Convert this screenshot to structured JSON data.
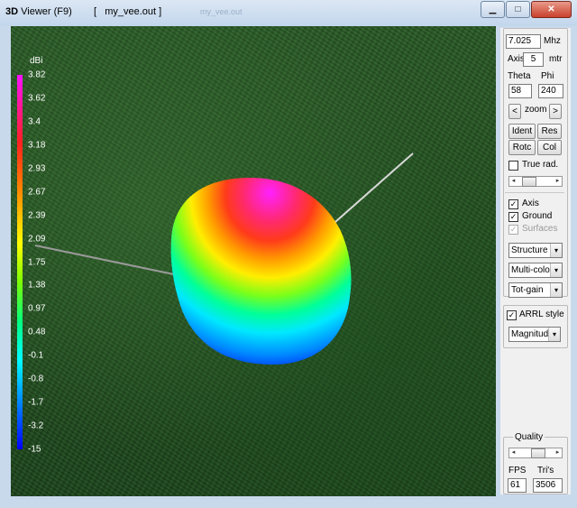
{
  "window": {
    "title_prefix": "3D",
    "title_main": "Viewer (F9)",
    "title_file": "[   my_vee.out ]",
    "ghost_title": "my_vee.out",
    "buttons": {
      "minimize": "▁",
      "maximize": "□",
      "close": "✕"
    }
  },
  "scale": {
    "unit": "dBi",
    "ticks": [
      "3.82",
      "3.62",
      "3.4",
      "3.18",
      "2.93",
      "2.67",
      "2.39",
      "2.09",
      "1.75",
      "1.38",
      "0.97",
      "0.48",
      "-0.1",
      "-0.8",
      "-1.7",
      "-3.2",
      "-15"
    ]
  },
  "panel": {
    "frequency": {
      "value": "7.025",
      "unit": "Mhz"
    },
    "axis": {
      "label": "Axis",
      "value": "5",
      "unit": "mtr"
    },
    "theta": {
      "label": "Theta",
      "value": "58"
    },
    "phi": {
      "label": "Phi",
      "value": "240"
    },
    "zoom": {
      "label": "zoom",
      "prev": "<",
      "next": ">"
    },
    "buttons": {
      "ident": "Ident",
      "res": "Res",
      "rotc": "Rotc",
      "col": "Col"
    },
    "true_rad": {
      "label": "True rad.",
      "checked": false
    },
    "show": [
      {
        "label": "Axis",
        "checked": true,
        "disabled": false
      },
      {
        "label": "Ground",
        "checked": true,
        "disabled": false
      },
      {
        "label": "Surfaces",
        "checked": true,
        "disabled": true
      }
    ],
    "selects": {
      "view": "Structure",
      "coloring": "Multi-colo",
      "gain": "Tot-gain"
    },
    "arrl": {
      "label": "ARRL style",
      "checked": true,
      "select": "Magnitud"
    },
    "quality": {
      "label": "Quality",
      "fps_label": "FPS",
      "fps": "61",
      "tris_label": "Tri's",
      "tris": "3506"
    }
  },
  "colors": {
    "accent_magenta": "#ff10ff",
    "ground_green": "#245022",
    "panel_bg": "#f0f0f0"
  }
}
